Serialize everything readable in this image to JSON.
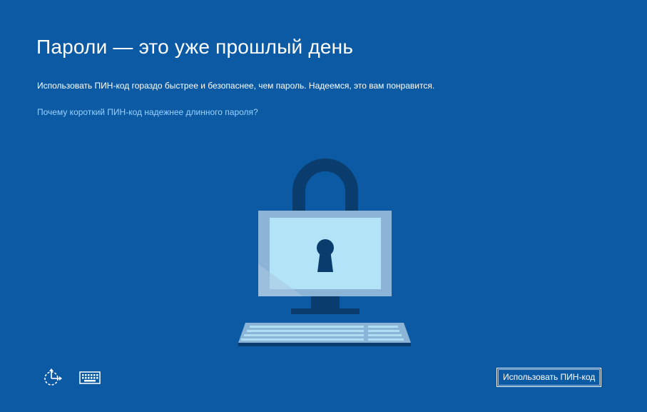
{
  "page": {
    "title": "Пароли — это уже прошлый день",
    "description": "Использовать ПИН-код гораздо быстрее и безопаснее, чем пароль. Надеемся, это вам понравится.",
    "link": "Почему короткий ПИН-код надежнее длинного пароля?"
  },
  "footer": {
    "ease_of_access_icon": "ease-of-access-icon",
    "keyboard_icon": "on-screen-keyboard-icon",
    "primary_button": "Использовать ПИН-код"
  },
  "colors": {
    "background": "#0b5aa3",
    "link": "#99d1ff",
    "illustration_dark": "#0a3d6e",
    "illustration_light": "#b3e3f7"
  }
}
